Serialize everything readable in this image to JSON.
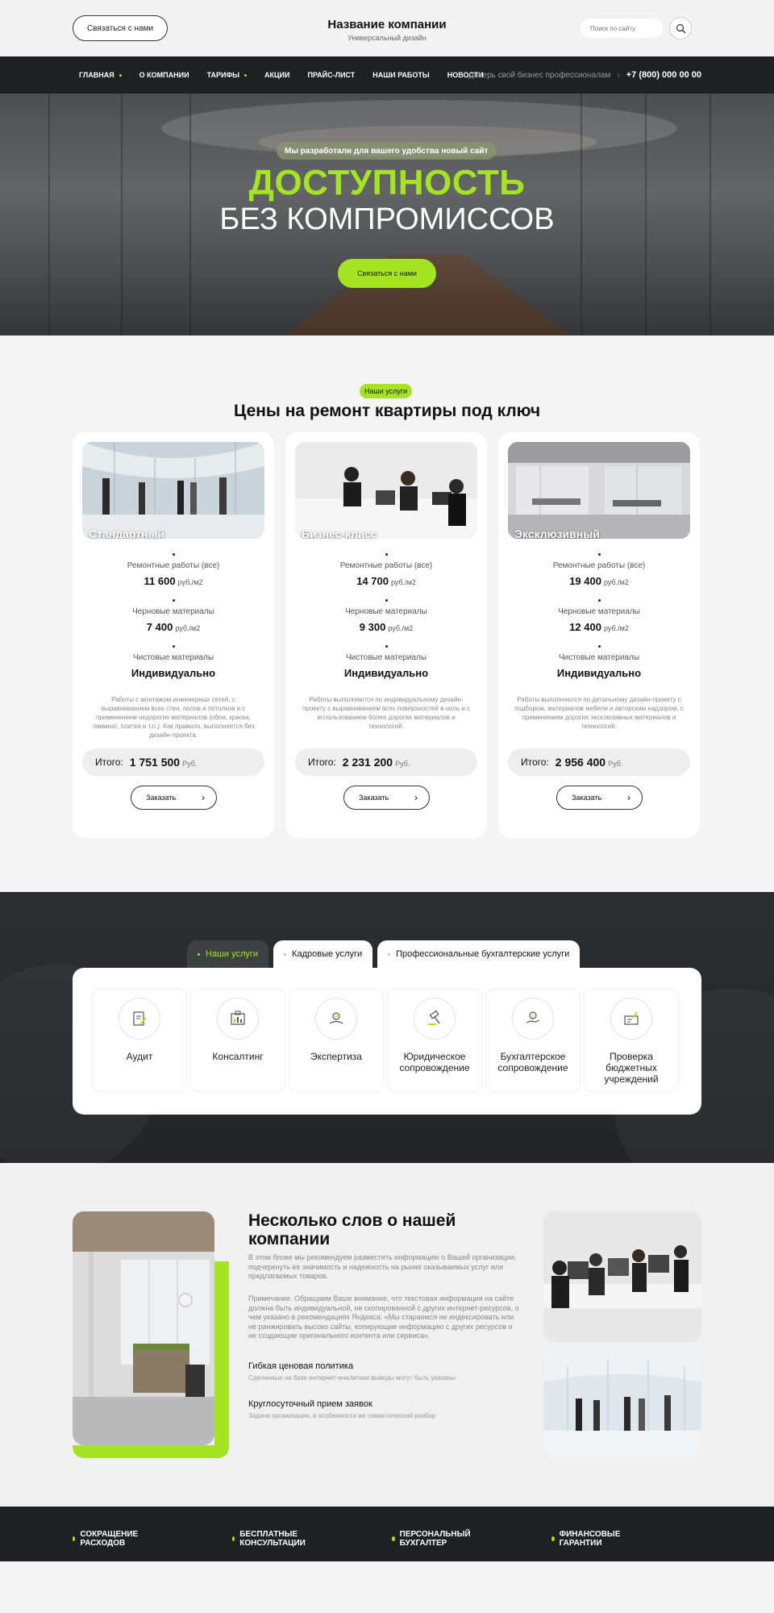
{
  "header": {
    "contact_button": "Связаться с нами",
    "company_name": "Название компании",
    "company_sub": "Универсальный дизайн",
    "search_placeholder": "Поиск по сайту"
  },
  "nav": {
    "items": [
      {
        "label": "ГЛАВНАЯ",
        "dot": true
      },
      {
        "label": "О КОМПАНИИ",
        "dot": false
      },
      {
        "label": "ТАРИФЫ",
        "dot": true
      },
      {
        "label": "АКЦИИ",
        "dot": false
      },
      {
        "label": "ПРАЙС-ЛИСТ",
        "dot": false
      },
      {
        "label": "НАШИ РАБОТЫ",
        "dot": false
      },
      {
        "label": "НОВОСТИ",
        "dot": false
      }
    ],
    "tagline": "Доверь свой бизнес профессионалам",
    "phone": "+7 (800) 000 00 00"
  },
  "hero": {
    "badge": "Мы разработали для вашего удобства новый сайт",
    "title1": "ДОСТУПНОСТЬ",
    "title2": "БЕЗ КОМПРОМИССОВ",
    "cta": "Связаться с нами"
  },
  "prices": {
    "pill": "Наши услуги",
    "title": "Цены на ремонт квартиры под ключ",
    "cards": [
      {
        "name": "Стандартный",
        "rows": [
          {
            "label": "Ремонтные работы (все)",
            "value": "11 600",
            "unit": "руб./м2"
          },
          {
            "label": "Черновые материалы",
            "value": "7 400",
            "unit": "руб./м2"
          },
          {
            "label": "Чистовые материалы",
            "value": "Индивидуально",
            "unit": ""
          }
        ],
        "desc": "Работы с монтажом  инженерных сетей, с выравниванием всех стен, полов и потолков и с применением недорогих материалов (обои, краска, ламинат, плитка и т.п.). Как правило, выполняется без дизайн-проекта.",
        "total_label": "Итого:",
        "total_value": "1 751 500",
        "total_unit": "Руб.",
        "order": "Заказать"
      },
      {
        "name": "Бизнес-класс",
        "rows": [
          {
            "label": "Ремонтные работы (все)",
            "value": "14 700",
            "unit": "руб./м2"
          },
          {
            "label": "Черновые материалы",
            "value": "9 300",
            "unit": "руб./м2"
          },
          {
            "label": "Чистовые материалы",
            "value": "Индивидуально",
            "unit": ""
          }
        ],
        "desc": "Работы выполняются по индивидуальному дизайн-проекту с выравниванием всех поверхностей в ноль и с использованием более дорогих материалов и технологий.",
        "total_label": "Итого:",
        "total_value": "2 231 200",
        "total_unit": "Руб.",
        "order": "Заказать"
      },
      {
        "name": "Эксклюзивный",
        "rows": [
          {
            "label": "Ремонтные работы (все)",
            "value": "19 400",
            "unit": "руб./м2"
          },
          {
            "label": "Черновые материалы",
            "value": "12 400",
            "unit": "руб./м2"
          },
          {
            "label": "Чистовые материалы",
            "value": "Индивидуально",
            "unit": ""
          }
        ],
        "desc": "Работы выполняются по детальному дизайн-проекту с подбором, материалов мебели и авторским надзором, с применением дорогих эксклюзивных материалов и технологий.",
        "total_label": "Итого:",
        "total_value": "2 956 400",
        "total_unit": "Руб.",
        "order": "Заказать"
      }
    ]
  },
  "services": {
    "tabs": [
      {
        "label": "Наши услуги",
        "active": true
      },
      {
        "label": "Кадровые услуги",
        "active": false
      },
      {
        "label": "Профессиональные бухгалтерские услуги",
        "active": false
      }
    ],
    "items": [
      {
        "label": "Аудит",
        "icon": "audit-icon"
      },
      {
        "label": "Консалтинг",
        "icon": "consulting-icon"
      },
      {
        "label": "Экспертиза",
        "icon": "expertise-icon"
      },
      {
        "label": "Юридическое сопровождение",
        "icon": "gavel-icon"
      },
      {
        "label": "Бухгалтерское сопровождение",
        "icon": "money-hand-icon"
      },
      {
        "label": "Проверка бюджетных учреждений",
        "icon": "inspection-icon"
      }
    ]
  },
  "about": {
    "title": "Несколько слов о нашей компании",
    "p1": "В этом блоке мы рекомендуем разместить информацию о Вашей организации, подчеркнуть ее значимость и надежность на рынке оказываемых услуг или предлагаемых товаров.",
    "p2": "Примечание. Обращаем Ваше внимание, что текстовая информация на сайте должна быть индивидуальной, не скопированной с других интернет-ресурсов, о чем указано в рекомендациях Яндекса: «Мы стараемся не индексировать или не ранжировать высоко сайты, копирующие информацию с других ресурсов и не создающие оригинального контента или сервиса».",
    "features": [
      {
        "title": "Гибкая ценовая политика",
        "sub": "Сделанные на базе интернет-аналитики выводы могут быть указаны"
      },
      {
        "title": "Круглосуточный прием заявок",
        "sub": "Задача организации, в особенности же семантический разбор"
      }
    ]
  },
  "strip": {
    "items": [
      "СОКРАЩЕНИЕ РАСХОДОВ",
      "БЕСПЛАТНЫЕ КОНСУЛЬТАЦИИ",
      "ПЕРСОНАЛЬНЫЙ БУХГАЛТЕР",
      "ФИНАНСОВЫЕ ГАРАНТИИ"
    ]
  },
  "colors": {
    "accent": "#a4e422",
    "dark": "#1e2024"
  }
}
